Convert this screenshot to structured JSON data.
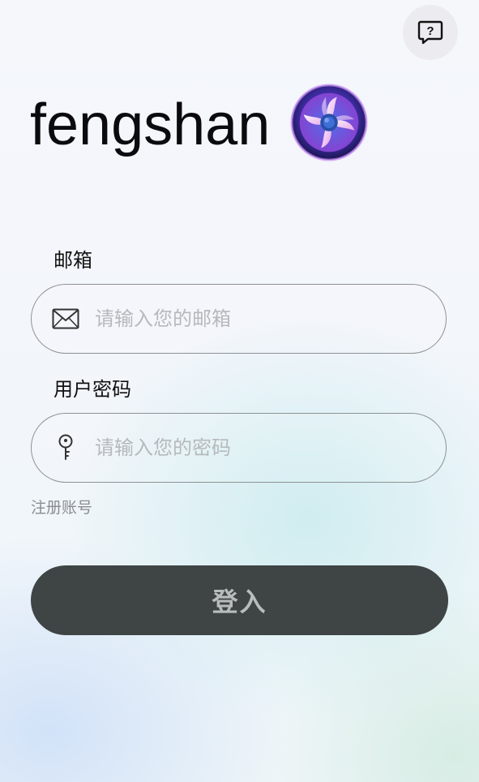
{
  "header": {
    "help_icon": "help-chat-icon"
  },
  "brand": {
    "title": "fengshan",
    "logo_icon": "fan-logo-icon"
  },
  "form": {
    "email": {
      "label": "邮箱",
      "placeholder": "请输入您的邮箱",
      "value": "",
      "icon": "mail-icon"
    },
    "password": {
      "label": "用户密码",
      "placeholder": "请输入您的密码",
      "value": "",
      "icon": "key-icon"
    },
    "register_link": "注册账号",
    "login_button": "登入"
  },
  "colors": {
    "button_bg": "#3f4445",
    "button_text": "#b9bcbd",
    "placeholder": "#b6b9bc",
    "link": "#8a8d92"
  }
}
